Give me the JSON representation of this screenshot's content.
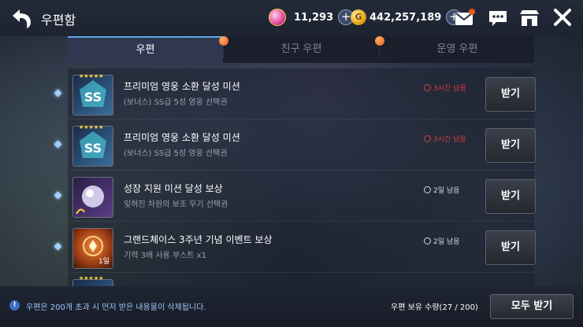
{
  "header": {
    "title": "우편함",
    "gems": "11,293",
    "gold": "442,257,189"
  },
  "tabs": [
    {
      "label": "우편",
      "active": true,
      "badge": true
    },
    {
      "label": "친구 우편",
      "active": false,
      "badge": true
    },
    {
      "label": "운영 우편",
      "active": false,
      "badge": false
    }
  ],
  "mails": [
    {
      "name": "프리미엄 영웅 소환 달성 미션",
      "desc": "(보너스) SS급 5성 영웅 선택권",
      "time": "3시간 남음",
      "urgent": true,
      "icon": "ss-ticket-icon",
      "button": "받기"
    },
    {
      "name": "프리미엄 영웅 소환 달성 미션",
      "desc": "(보너스) SS급 5성 영웅 선택권",
      "time": "3시간 남음",
      "urgent": true,
      "icon": "ss-ticket-icon",
      "button": "받기"
    },
    {
      "name": "성장 지원 미션 달성 보상",
      "desc": "잊혀진 차원의 보조 무기 선택권",
      "time": "2일 남음",
      "urgent": false,
      "icon": "orb-icon",
      "button": "받기"
    },
    {
      "name": "그랜드체이스 3주년 기념 이벤트 보상",
      "desc": "기력 3배 사용 부스트 x1",
      "time": "2일 남음",
      "urgent": false,
      "icon": "boost-icon",
      "badge": "1일",
      "button": "받기"
    }
  ],
  "footer": {
    "notice": "우편은 200개 초과 시 먼저 받은 내용물이 삭제됩니다.",
    "count": "우편 보유 수량(27 / 200)",
    "receive_all": "모두 받기"
  },
  "colors": {
    "urgent": "#e23b3b",
    "normal": "#d8d8d8",
    "accent": "#5fa7e8"
  }
}
